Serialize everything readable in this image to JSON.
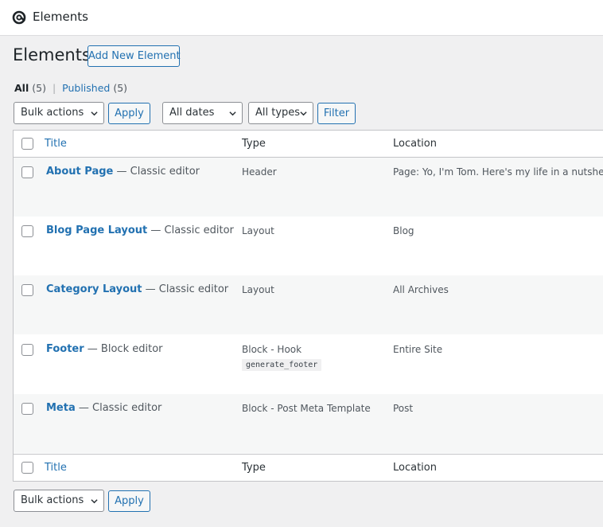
{
  "app": {
    "logo_icon": "generatepress-logo-icon",
    "title": "Elements"
  },
  "page": {
    "heading": "Elements",
    "add_new_label": "Add New Element"
  },
  "views": {
    "all_label": "All",
    "all_count": "(5)",
    "separator": "|",
    "published_label": "Published",
    "published_count": "(5)"
  },
  "filters": {
    "bulk_actions": "Bulk actions",
    "apply_label": "Apply",
    "dates": "All dates",
    "types": "All types",
    "filter_label": "Filter"
  },
  "table": {
    "columns": {
      "title": "Title",
      "type": "Type",
      "location": "Location"
    },
    "rows": [
      {
        "title": "About Page",
        "state": " — Classic editor",
        "type": "Header",
        "location": "Page: Yo, I'm Tom. Here's my life in a nutshell.",
        "hook": ""
      },
      {
        "title": "Blog Page Layout",
        "state": " — Classic editor",
        "type": "Layout",
        "location": "Blog",
        "hook": ""
      },
      {
        "title": "Category Layout",
        "state": " — Classic editor",
        "type": "Layout",
        "location": "All Archives",
        "hook": ""
      },
      {
        "title": "Footer",
        "state": " — Block editor",
        "type": "Block - Hook",
        "location": "Entire Site",
        "hook": "generate_footer"
      },
      {
        "title": "Meta",
        "state": " — Classic editor",
        "type": "Block - Post Meta Template",
        "location": "Post",
        "hook": ""
      }
    ]
  },
  "bottom": {
    "bulk_actions": "Bulk actions",
    "apply_label": "Apply"
  },
  "colors": {
    "accent": "#2271b1",
    "background": "#f0f0f1",
    "alt_row": "#f6f7f7"
  }
}
